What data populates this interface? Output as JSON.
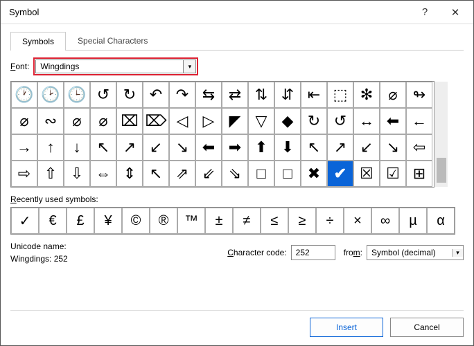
{
  "title": "Symbol",
  "tabs": {
    "symbols": "Symbols",
    "special": "Special Characters"
  },
  "font": {
    "label": "Font:",
    "label_u": "F",
    "value": "Wingdings"
  },
  "grid": [
    [
      "🕐",
      "🕑",
      "🕒",
      "↺",
      "↻",
      "↶",
      "↷",
      "⇆",
      "⇄",
      "⇅",
      "⇵",
      "⇤",
      "⬚",
      "✻",
      "⌀",
      "↬"
    ],
    [
      "⌀",
      "∾",
      "⌀",
      "⌀",
      "⌧",
      "⌦",
      "◁",
      "▷",
      "◤",
      "▽",
      "◆",
      "↻",
      "↺",
      "↔",
      "⬅",
      "←"
    ],
    [
      "→",
      "↑",
      "↓",
      "↖",
      "↗",
      "↙",
      "↘",
      "⬅",
      "➡",
      "⬆",
      "⬇",
      "↖",
      "↗",
      "↙",
      "↘",
      "⇦"
    ],
    [
      "⇨",
      "⇧",
      "⇩",
      "⇔",
      "⇕",
      "↖",
      "⇗",
      "⇙",
      "⇘",
      "□",
      "□",
      "✖",
      "✔",
      "☒",
      "☑",
      "⊞"
    ]
  ],
  "selected": {
    "row": 3,
    "col": 12
  },
  "recent": {
    "label": "Recently used symbols:",
    "label_u": "R",
    "items": [
      "✓",
      "€",
      "£",
      "¥",
      "©",
      "®",
      "™",
      "±",
      "≠",
      "≤",
      "≥",
      "÷",
      "×",
      "∞",
      "µ",
      "α"
    ]
  },
  "unicode": {
    "label": "Unicode name:",
    "value": "Wingdings: 252"
  },
  "charcode": {
    "label": "Character code:",
    "label_u": "C",
    "value": "252"
  },
  "from": {
    "label": "from:",
    "label_u": "m",
    "value": "Symbol (decimal)"
  },
  "buttons": {
    "insert": "Insert",
    "cancel": "Cancel"
  }
}
